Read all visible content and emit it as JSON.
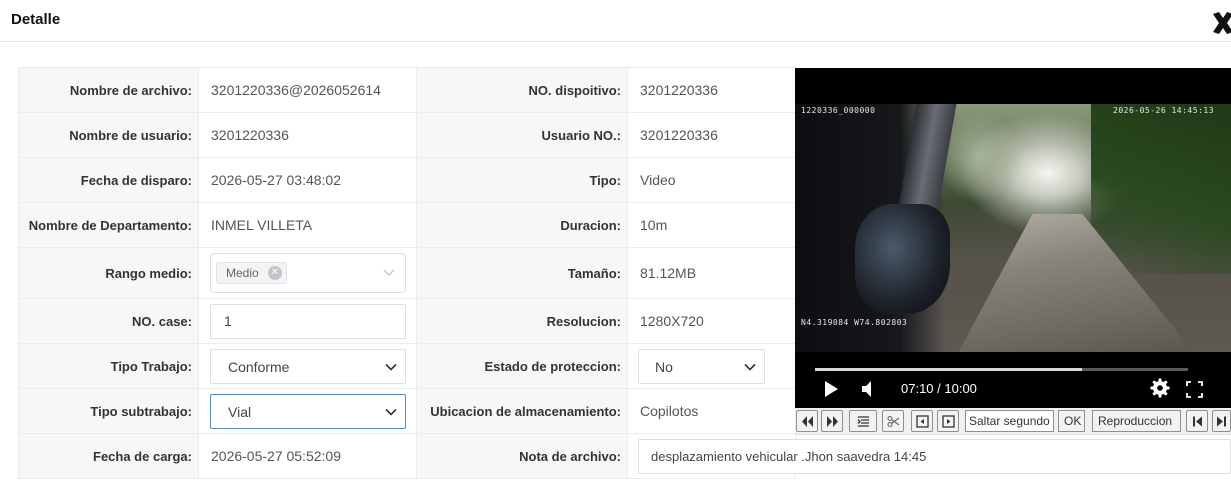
{
  "dialog": {
    "title": "Detalle"
  },
  "fields": {
    "file_name": {
      "label": "Nombre de archivo:",
      "value": "3201220336@2026052614"
    },
    "device_no": {
      "label": "NO. dispoitivo:",
      "value": "3201220336"
    },
    "user_name": {
      "label": "Nombre de usuario:",
      "value": "3201220336"
    },
    "user_no": {
      "label": "Usuario NO.:",
      "value": "3201220336"
    },
    "trigger_date": {
      "label": "Fecha de disparo:",
      "value": "2026-05-27 03:48:02"
    },
    "type": {
      "label": "Tipo:",
      "value": "Video"
    },
    "department": {
      "label": "Nombre de Departamento:",
      "value": "INMEL VILLETA"
    },
    "duration": {
      "label": "Duracion:",
      "value": "10m"
    },
    "media_range": {
      "label": "Rango medio:",
      "tag": "Medio"
    },
    "size": {
      "label": "Tamaño:",
      "value": "81.12MB"
    },
    "case_no": {
      "label": "NO. case:",
      "value": "1"
    },
    "resolution": {
      "label": "Resolucion:",
      "value": "1280X720"
    },
    "work_type": {
      "label": "Tipo Trabajo:",
      "value": "Conforme"
    },
    "protection_state": {
      "label": "Estado de proteccion:",
      "value": "No"
    },
    "work_subtype": {
      "label": "Tipo subtrabajo:",
      "value": "Vial"
    },
    "storage_location": {
      "label": "Ubicacion de almacenamiento:",
      "value": "Copilotos"
    },
    "upload_date": {
      "label": "Fecha de carga:",
      "value": "2026-05-27 05:52:09"
    },
    "file_note": {
      "label": "Nota de archivo:",
      "value": "desplazamiento vehicular .Jhon saavedra 14:45"
    }
  },
  "video": {
    "osd_id": "1220336_000000",
    "osd_timestamp": "2026-05-26 14:45:13",
    "osd_gps": "N4.319084 W74.802803",
    "time_display": "07:10 / 10:00",
    "progress_fraction": 0.717
  },
  "toolbar": {
    "skip_input_value": "Saltar segundo",
    "ok_label": "OK",
    "playback_label": "Reproduccion"
  },
  "colors": {
    "label_bg": "#f7f7f7",
    "border": "#ececec",
    "focus_border": "#5b8dc9"
  }
}
